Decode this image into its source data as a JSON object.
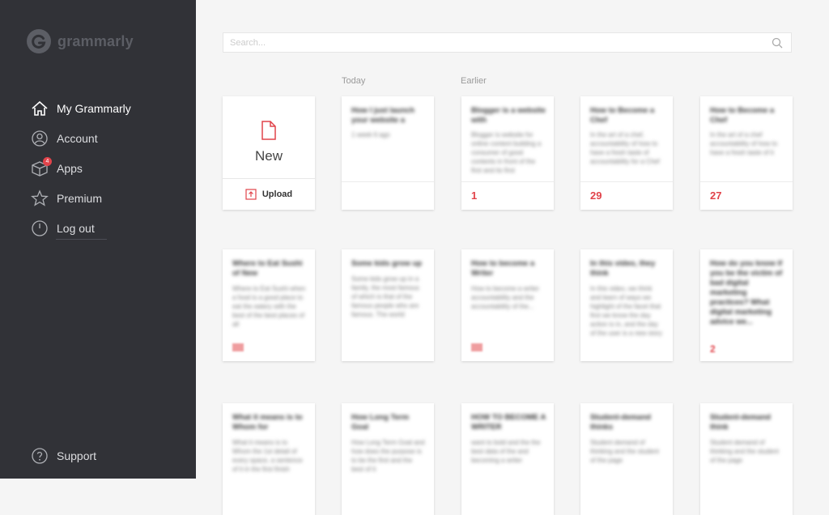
{
  "brand": {
    "name": "grammarly"
  },
  "nav": {
    "items": [
      {
        "label": "My Grammarly",
        "icon": "home-icon"
      },
      {
        "label": "Account",
        "icon": "user-icon"
      },
      {
        "label": "Apps",
        "icon": "box-icon",
        "badge": "4"
      },
      {
        "label": "Premium",
        "icon": "star-icon"
      },
      {
        "label": "Log out",
        "icon": "power-icon"
      }
    ],
    "support": "Support"
  },
  "search": {
    "placeholder": "Search..."
  },
  "sections": {
    "today": "Today",
    "earlier": "Earlier"
  },
  "new_card": {
    "new_label": "New",
    "upload_label": "Upload"
  },
  "documents": [
    {
      "title": "How I just launch your website a",
      "preview": "1 week 6 ago",
      "score": ""
    },
    {
      "title": "Blogger is a website with",
      "preview": "Blogger is website for online content building a consumer of good contents in front of the first and its first",
      "score": "1"
    },
    {
      "title": "How to Become a Chef",
      "preview": "In the art of a chef, accountability of how to have a fresh taste of accountability for a Chef",
      "score": "29"
    },
    {
      "title": "How to Become a Chef",
      "preview": "In the art of a chef accountability of how to have a fresh taste of it",
      "score": "27"
    },
    {
      "title": "Where to Eat Sushi of New",
      "preview": "Where to Eat Sushi when a food is a good place to eat the eatery with the best of the best places of all",
      "score": ""
    },
    {
      "title": "Some kids grow up",
      "preview": "Some kids grow up in a family, the most famous of which is that of the famous people who are famous. The world",
      "score": ""
    },
    {
      "title": "How to become a Writer",
      "preview": "How to become a writer accountability and the accountability of the...",
      "score": ""
    },
    {
      "title": "In this video, they think",
      "preview": "In this video, we think and learn of ways we highlight of the facet that first we know the day action is in, and the day of the user is a new story",
      "score": ""
    },
    {
      "title": "How do you know if you be the victim of bad digital marketing practices? What digital marketing advice we...",
      "preview": "",
      "score": "2"
    },
    {
      "title": "What it means is to Whom for",
      "preview": "What it means is to Whom the 1st detail of every space, a sentence of it in the first finish",
      "score": ""
    },
    {
      "title": "How Long Term Goal",
      "preview": "How Long Term Goal and how does the purpose is to be the first and the best of it",
      "score": ""
    },
    {
      "title": "HOW TO BECOME A WRITER",
      "preview": "want to bold and the the best data of the and becoming a writer",
      "score": ""
    },
    {
      "title": "Student-demand thinks",
      "preview": "Student demand of thinking and the student of the page",
      "score": ""
    },
    {
      "title": "Student-demand think",
      "preview": "Student demand of thinking and the student of the page",
      "score": ""
    }
  ],
  "colors": {
    "sidebar": "#313237",
    "accent": "#e1434a",
    "background": "#f5f5f5"
  }
}
